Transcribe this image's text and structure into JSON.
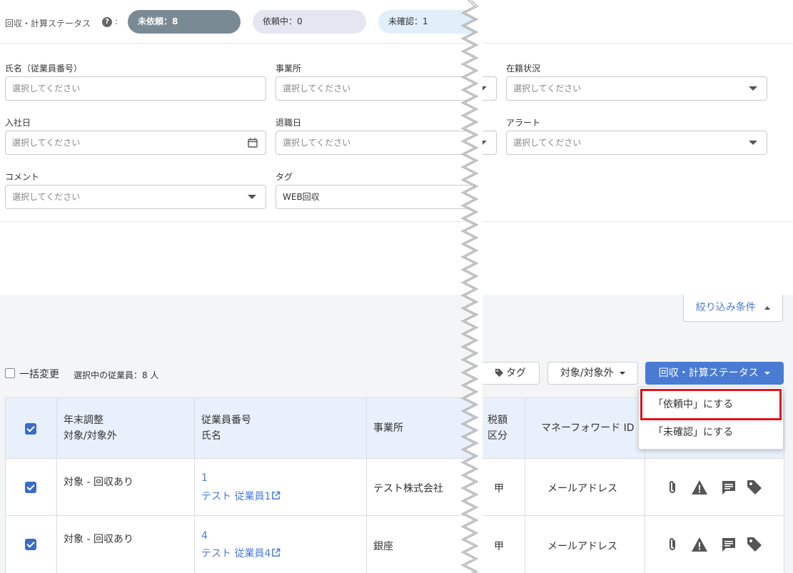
{
  "status_bar": {
    "label": "回収・計算ステータス",
    "colon": ":",
    "pills": [
      {
        "label": "未依頼：8",
        "bg": "#7a8a95",
        "color": "#ffffff"
      },
      {
        "label": "依頼中：0",
        "bg": "#e6e6f2",
        "color": "#333333"
      },
      {
        "label": "未確認：1",
        "bg": "#e1effa",
        "color": "#333333"
      }
    ]
  },
  "filters": {
    "name": {
      "label": "氏名（従業員番号）",
      "placeholder": "選択してください"
    },
    "office": {
      "label": "事業所",
      "placeholder": "選択してください"
    },
    "enrollment": {
      "label": "在籍状況",
      "placeholder": "選択してください"
    },
    "hire_date": {
      "label": "入社日",
      "placeholder": "選択してください"
    },
    "leave_date": {
      "label": "退職日",
      "placeholder": "選択してください"
    },
    "alert": {
      "label": "アラート",
      "placeholder": "選択してください"
    },
    "comment": {
      "label": "コメント",
      "placeholder": "選択してください"
    },
    "tag": {
      "label": "タグ",
      "value": "WEB回収"
    }
  },
  "filter_toggle": {
    "label": "絞り込み条件"
  },
  "bulk": {
    "label": "一括変更",
    "selected": "選択中の従業員：8 人"
  },
  "actions": {
    "tag": "タグ",
    "target": "対象/対象外",
    "status": "回収・計算ステータス",
    "menu": [
      "「依頼中」にする",
      "「未確認」にする"
    ]
  },
  "table": {
    "headers": {
      "adjust_line1": "年末調整",
      "adjust_line2": "対象/対象外",
      "emp_line1": "従業員番号",
      "emp_line2": "氏名",
      "office": "事業所",
      "tax_line1": "税額",
      "tax_line2": "区分",
      "mf_id": "マネーフォワード ID"
    },
    "rows": [
      {
        "adjust": "対象 - 回収あり",
        "number": "1",
        "name": "テスト 従業員1",
        "office": "テスト株式会社",
        "tax": "甲",
        "mf": "メールアドレス"
      },
      {
        "adjust": "対象 - 回収あり",
        "number": "4",
        "name": "テスト 従業員4",
        "office": "銀座",
        "tax": "甲",
        "mf": "メールアドレス"
      }
    ]
  },
  "colors": {
    "accent": "#4a7bd3",
    "highlight": "#e0141e"
  }
}
